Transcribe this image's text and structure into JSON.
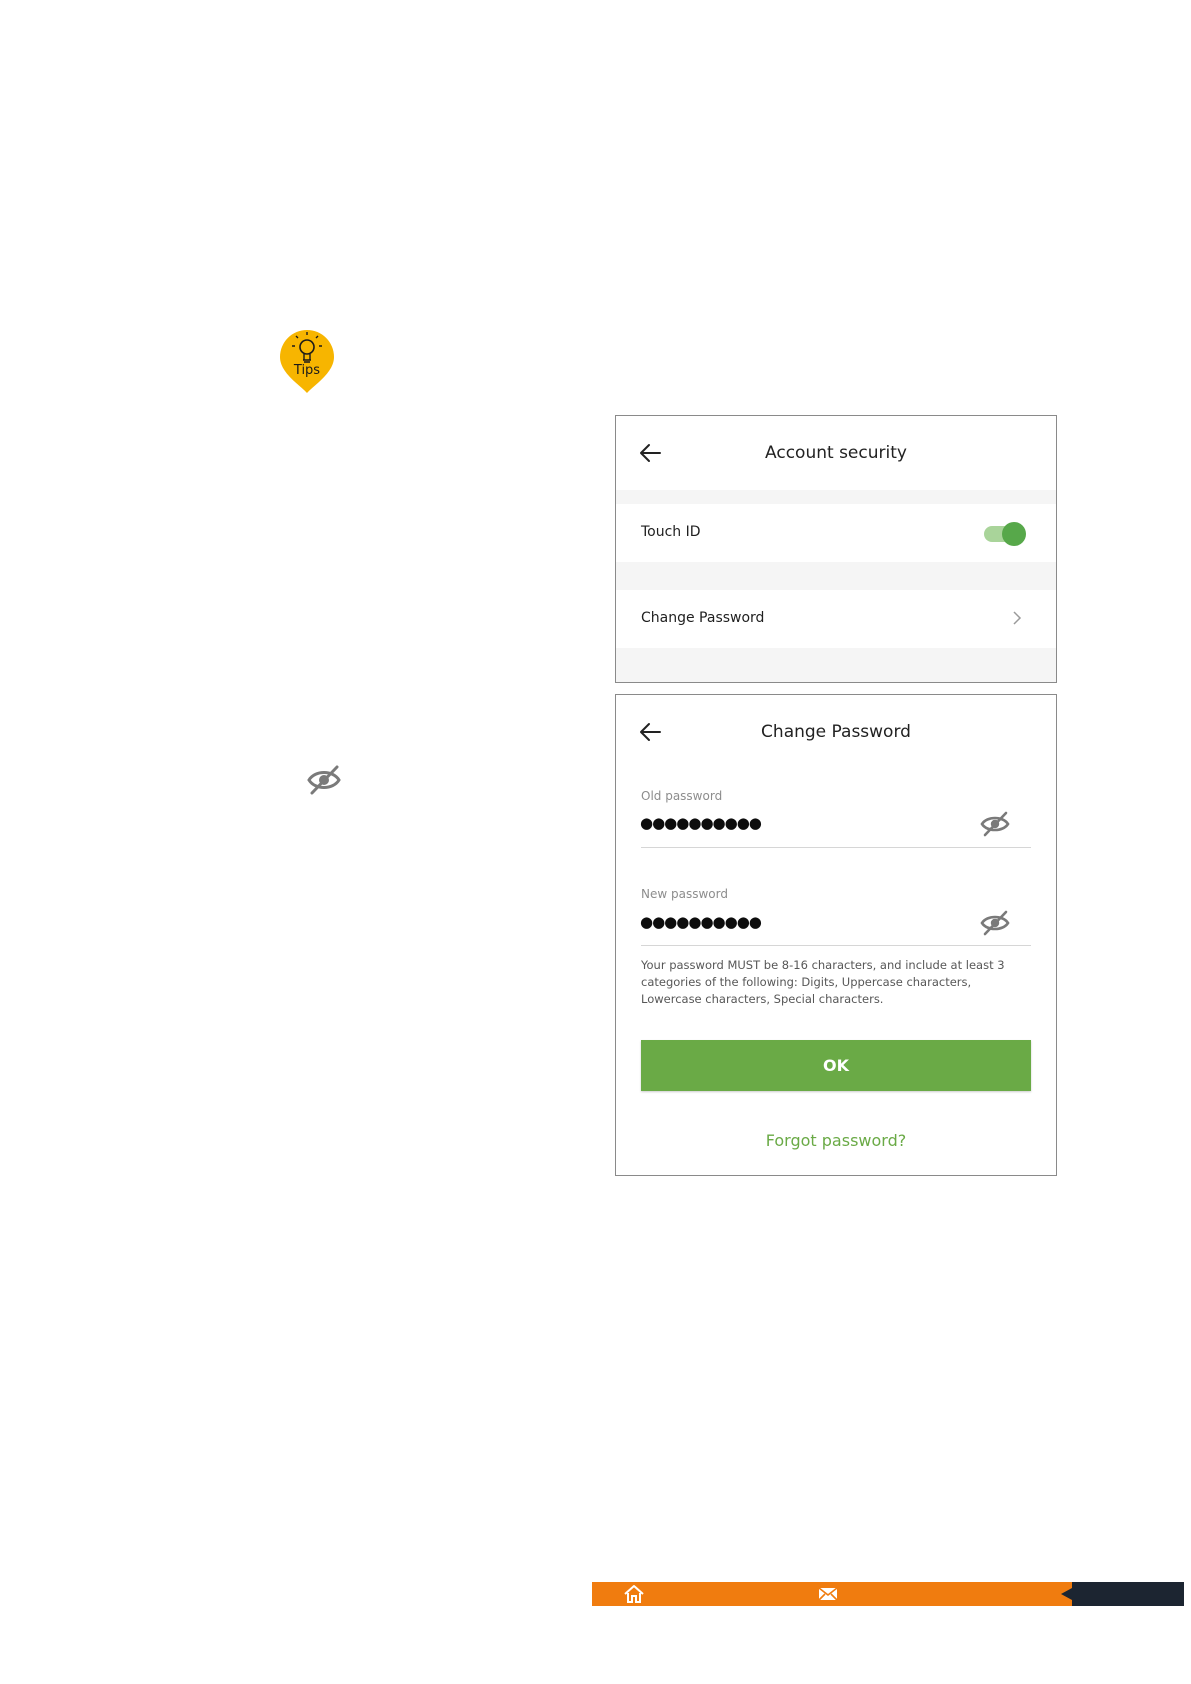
{
  "tips": {
    "label": "Tips"
  },
  "account_security": {
    "title": "Account security",
    "touch_id_label": "Touch ID",
    "touch_id_enabled": true,
    "change_password_label": "Change Password"
  },
  "change_password": {
    "title": "Change Password",
    "old_password_label": "Old password",
    "old_password_value": "●●●●●●●●●●",
    "new_password_label": "New password",
    "new_password_value": "●●●●●●●●●●",
    "hint": "Your password MUST be 8-16 characters, and include at least 3 categories of the following: Digits, Uppercase characters, Lowercase characters, Special characters.",
    "ok_label": "OK",
    "forgot_label": "Forgot password?"
  },
  "colors": {
    "accent_green": "#6aaa46",
    "tips_yellow": "#f7b500",
    "footer_orange": "#f07c0f",
    "footer_dark": "#1c2531"
  },
  "icons": [
    "lightbulb-icon",
    "eye-off-icon",
    "back-arrow-icon",
    "chevron-right-icon",
    "home-icon",
    "mail-icon"
  ]
}
